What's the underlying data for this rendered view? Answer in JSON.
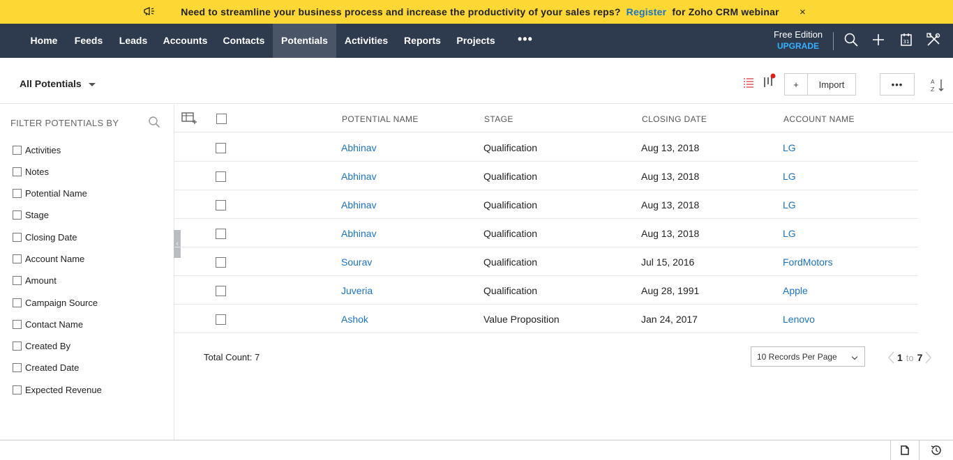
{
  "banner": {
    "message": "Need to streamline your business process and increase the productivity of your sales reps?",
    "link": "Register",
    "suffix": "for Zoho CRM webinar",
    "close": "×"
  },
  "nav": {
    "items": [
      "Home",
      "Feeds",
      "Leads",
      "Accounts",
      "Contacts",
      "Potentials",
      "Activities",
      "Reports",
      "Projects"
    ],
    "active": "Potentials",
    "more": "•••",
    "edition": "Free Edition",
    "upgrade": "UPGRADE"
  },
  "subheader": {
    "view": "All Potentials",
    "import_label": "Import",
    "add_label": "+",
    "more_label": "•••"
  },
  "filters": {
    "title": "FILTER POTENTIALS BY",
    "items": [
      "Activities",
      "Notes",
      "Potential Name",
      "Stage",
      "Closing Date",
      "Account Name",
      "Amount",
      "Campaign Source",
      "Contact Name",
      "Created By",
      "Created Date",
      "Expected Revenue"
    ]
  },
  "table": {
    "columns": [
      "POTENTIAL NAME",
      "STAGE",
      "CLOSING DATE",
      "ACCOUNT NAME"
    ],
    "rows": [
      {
        "name": "Abhinav",
        "stage": "Qualification",
        "date": "Aug 13, 2018",
        "account": "LG"
      },
      {
        "name": "Abhinav",
        "stage": "Qualification",
        "date": "Aug 13, 2018",
        "account": "LG"
      },
      {
        "name": "Abhinav",
        "stage": "Qualification",
        "date": "Aug 13, 2018",
        "account": "LG"
      },
      {
        "name": "Abhinav",
        "stage": "Qualification",
        "date": "Aug 13, 2018",
        "account": "LG"
      },
      {
        "name": "Sourav",
        "stage": "Qualification",
        "date": "Jul 15, 2016",
        "account": "FordMotors"
      },
      {
        "name": "Juveria",
        "stage": "Qualification",
        "date": "Aug 28, 1991",
        "account": "Apple"
      },
      {
        "name": "Ashok",
        "stage": "Value Proposition",
        "date": "Jan 24, 2017",
        "account": "Lenovo"
      }
    ]
  },
  "pagination": {
    "total": "Total Count: 7",
    "per_page": "10 Records Per Page",
    "from": "1",
    "to_word": "to",
    "to": "7"
  },
  "colors": {
    "banner_bg": "#fdd835",
    "nav_bg": "#2e3a4d",
    "link": "#1a73c7",
    "upgrade": "#35b2ff"
  }
}
